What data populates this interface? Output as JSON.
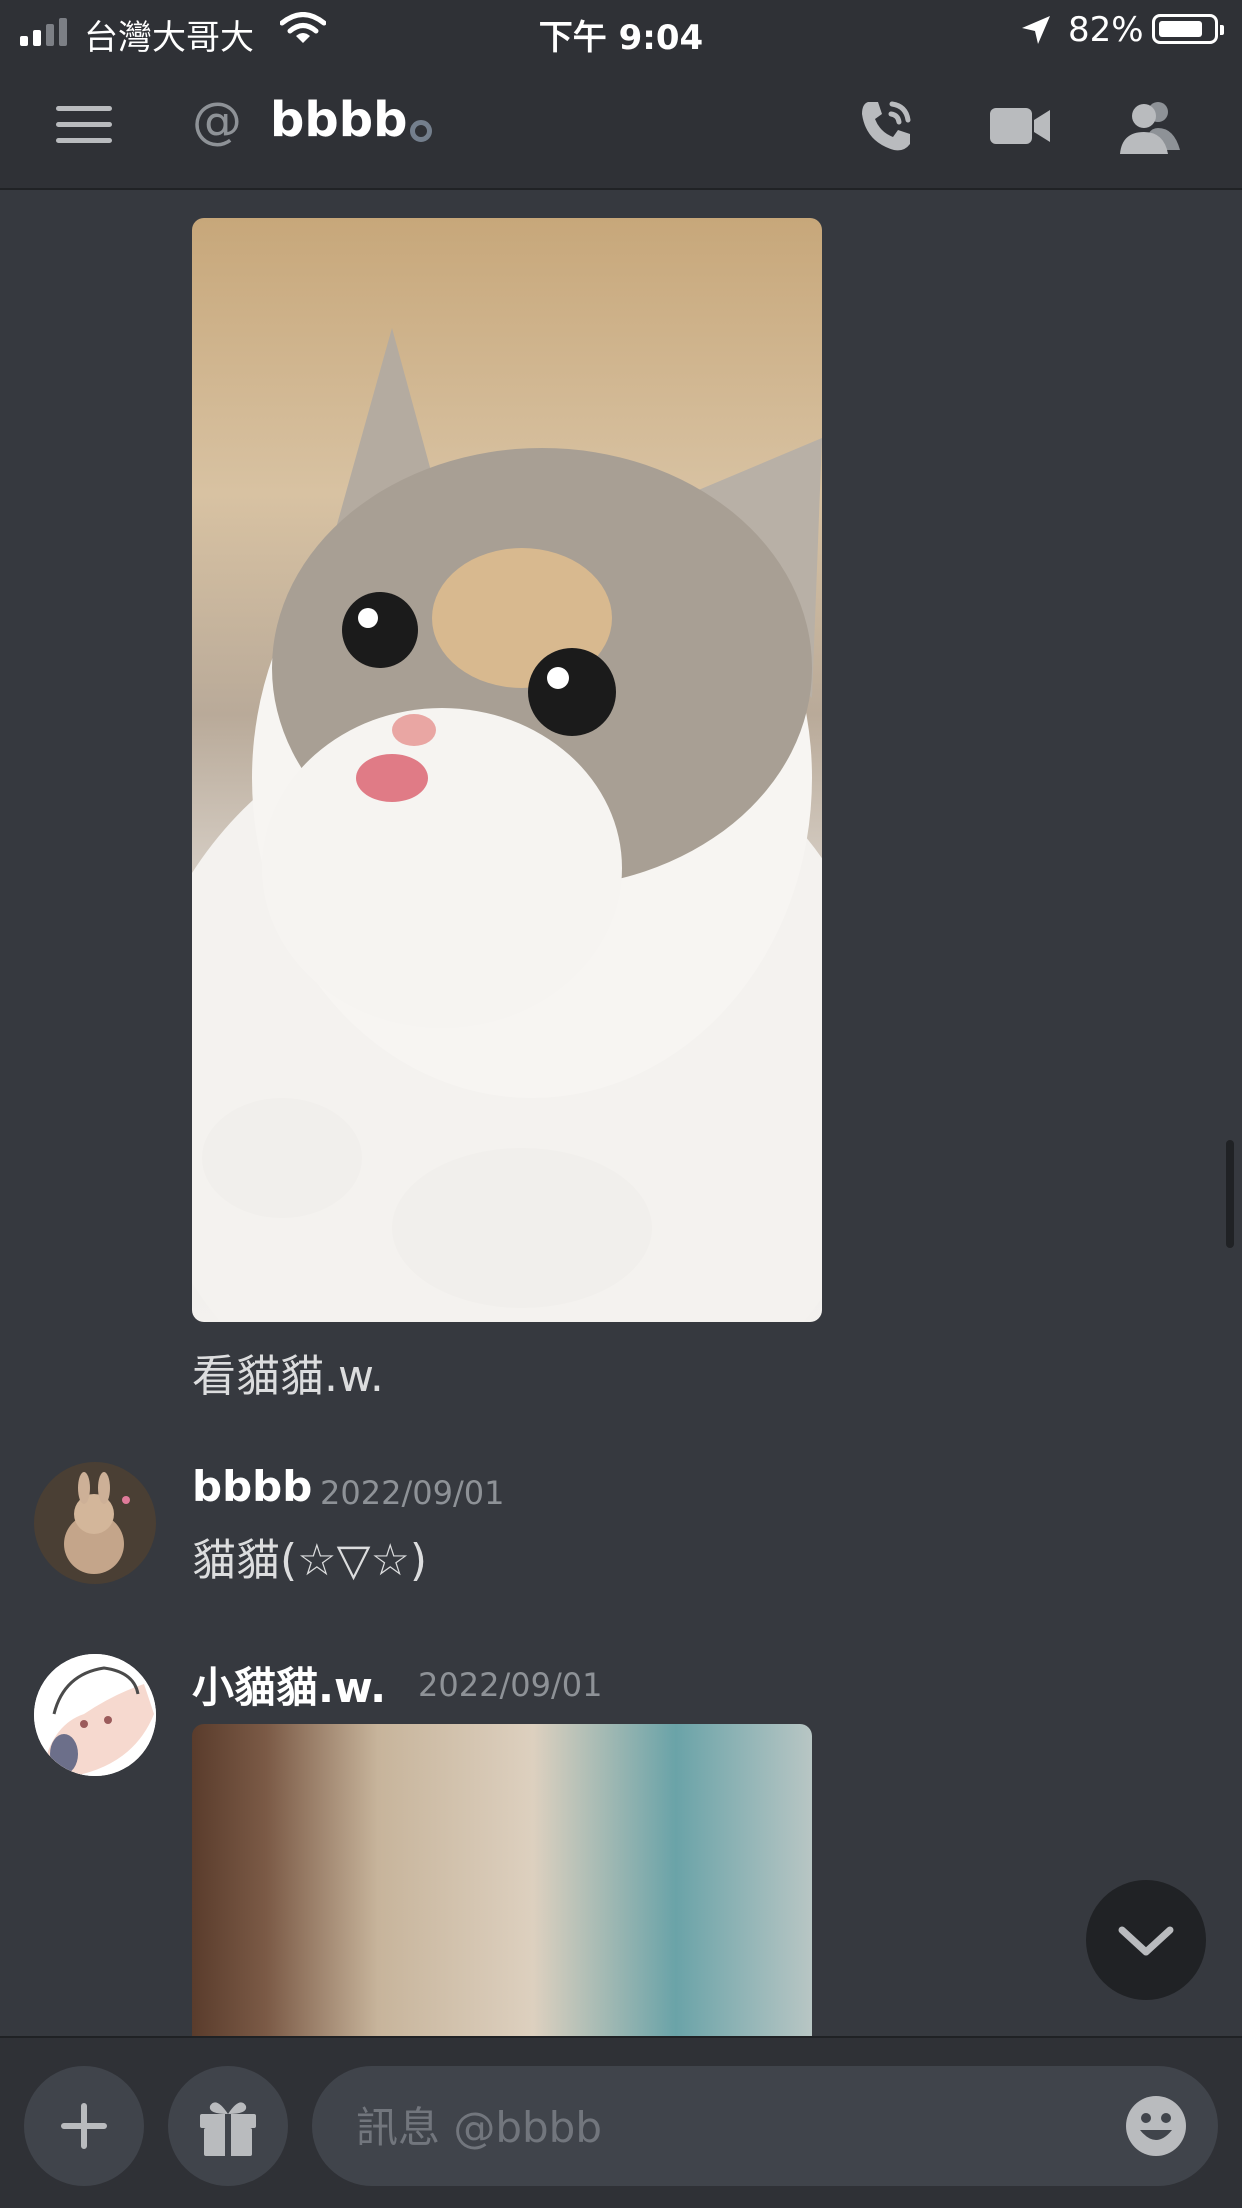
{
  "status_bar": {
    "carrier": "台灣大哥大",
    "time": "下午 9:04",
    "battery_percent": "82%",
    "battery_level": 0.82
  },
  "header": {
    "at_symbol": "@",
    "title": "bbbb",
    "icons": [
      "menu-icon",
      "phone-call-icon",
      "video-camera-icon",
      "members-icon"
    ]
  },
  "messages": [
    {
      "author": "",
      "timestamp": "",
      "image": "photo of a calico kitten licking its nose",
      "text": "看貓貓.w."
    },
    {
      "author": "bbbb",
      "timestamp": "2022/09/01",
      "text": "貓貓(☆▽☆)"
    },
    {
      "author": "小貓貓.w.",
      "timestamp": "2022/09/01",
      "image": "blurred photo"
    }
  ],
  "composer": {
    "placeholder": "訊息 @bbbb",
    "icons": [
      "plus-icon",
      "gift-icon",
      "emoji-icon"
    ]
  },
  "colors": {
    "background": "#36393f",
    "header": "#2f3136",
    "input": "#40444b",
    "text": "#dcddde",
    "muted": "#8e9297"
  }
}
